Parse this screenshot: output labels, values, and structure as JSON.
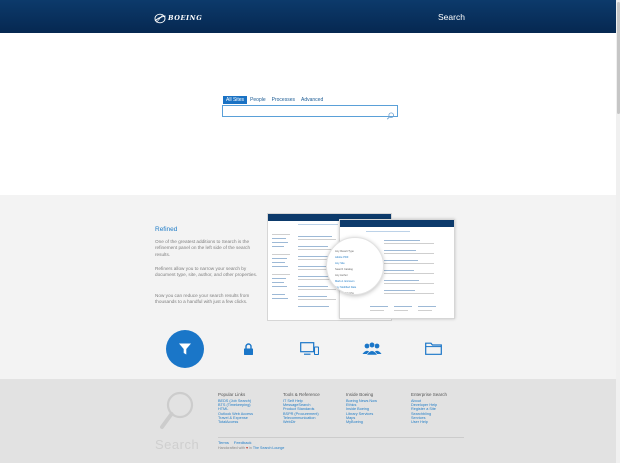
{
  "header": {
    "logo_text": "BOEING",
    "title": "Search"
  },
  "search": {
    "tabs": [
      {
        "label": "All Sites",
        "active": true
      },
      {
        "label": "People",
        "active": false
      },
      {
        "label": "Processes",
        "active": false
      },
      {
        "label": "Advanced",
        "active": false
      }
    ],
    "placeholder": "",
    "button_icon": "search-icon"
  },
  "feature": {
    "title": "Refined",
    "paragraphs": [
      "One of the greatest additions to Search is the refinement panel on the left side of the search results.",
      "Refiners allow you to narrow your search by document type, site, author, and other properties.",
      "Now you can reduce your search results from thousands to a handful with just a few clicks."
    ],
    "icons": [
      "filter-icon",
      "lock-icon",
      "computer-icon",
      "people-icon",
      "folder-icon"
    ],
    "accent_color": "#1a76c8"
  },
  "footer": {
    "search_word": "Search",
    "columns": [
      {
        "title": "Popular Links",
        "links": [
          "BEDS (Job Search)",
          "BTS (Timekeeping)",
          "HTML",
          "Outlook Web Access",
          "Travel & Expense",
          "TotalAccess"
        ]
      },
      {
        "title": "Tools & Reference",
        "links": [
          "IT Self Help",
          "MessageSearch",
          "Product Standards",
          "BSPR (Procurement)",
          "Telecommunication",
          "WebDir"
        ]
      },
      {
        "title": "Inside Boeing",
        "links": [
          "Boeing News Now",
          "Ethics",
          "Inside Boeing",
          "Library Services",
          "Maps",
          "MyBoeing"
        ]
      },
      {
        "title": "Enterprise Search",
        "links": [
          "About",
          "Developer Help",
          "Register a Site",
          "Searchbling",
          "Services",
          "User Help"
        ]
      }
    ],
    "bottom_links": [
      "Terms",
      "Feedback"
    ],
    "credit_prefix": "Handcrafted with",
    "credit_heart": "♥",
    "credit_mid": "in",
    "credit_link": "The Search Lounge"
  }
}
